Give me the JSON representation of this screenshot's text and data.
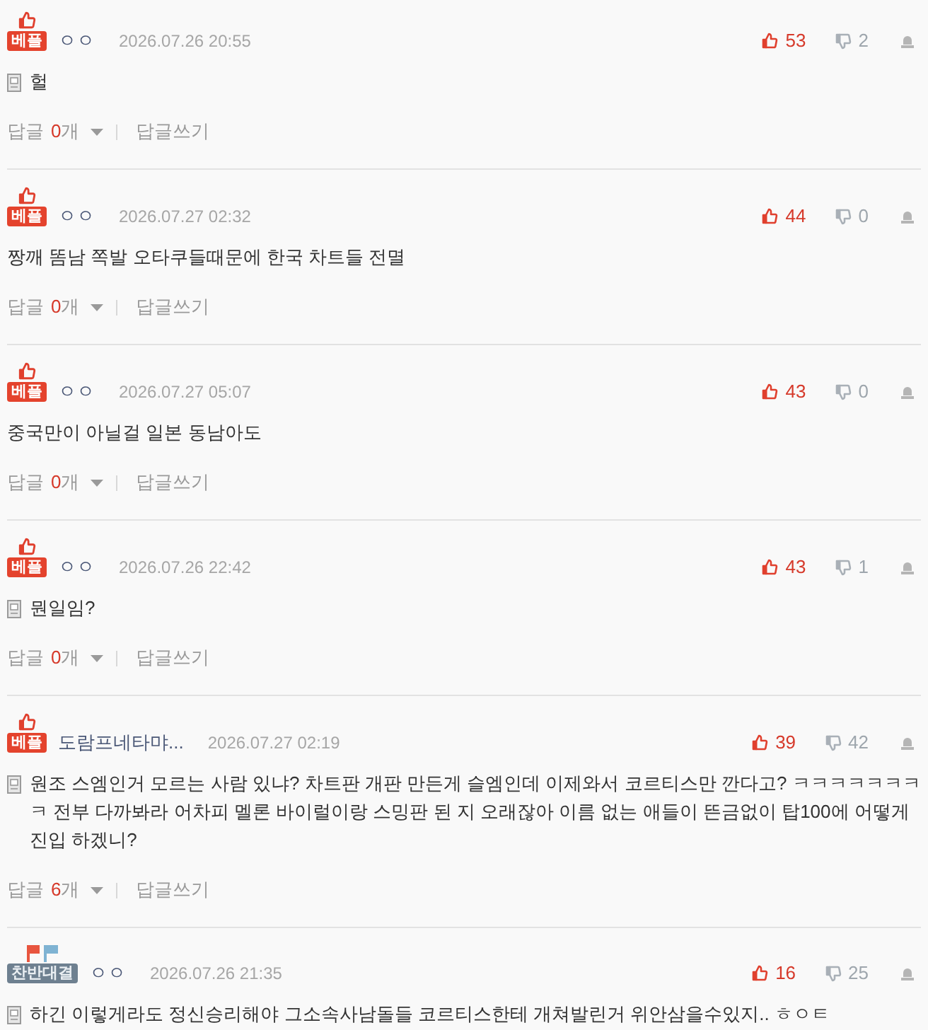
{
  "comments": [
    {
      "badge": {
        "kind": "best",
        "label": "베플"
      },
      "nickname": "ㅇㅇ",
      "date": "2026.07.26 20:55",
      "likes": "53",
      "dislikes": "2",
      "memo": true,
      "text": "헐",
      "replies": {
        "label": "답글",
        "count": "0",
        "unit": "개"
      },
      "write_reply": "답글쓰기"
    },
    {
      "badge": {
        "kind": "best",
        "label": "베플"
      },
      "nickname": "ㅇㅇ",
      "date": "2026.07.27 02:32",
      "likes": "44",
      "dislikes": "0",
      "memo": false,
      "text": "짱깨 똠남 쪽발 오타쿠들때문에 한국 차트들 전멸",
      "replies": {
        "label": "답글",
        "count": "0",
        "unit": "개"
      },
      "write_reply": "답글쓰기"
    },
    {
      "badge": {
        "kind": "best",
        "label": "베플"
      },
      "nickname": "ㅇㅇ",
      "date": "2026.07.27 05:07",
      "likes": "43",
      "dislikes": "0",
      "memo": false,
      "text": "중국만이 아닐걸 일본 동남아도",
      "replies": {
        "label": "답글",
        "count": "0",
        "unit": "개"
      },
      "write_reply": "답글쓰기"
    },
    {
      "badge": {
        "kind": "best",
        "label": "베플"
      },
      "nickname": "ㅇㅇ",
      "date": "2026.07.26 22:42",
      "likes": "43",
      "dislikes": "1",
      "memo": true,
      "text": "뭔일임?",
      "replies": {
        "label": "답글",
        "count": "0",
        "unit": "개"
      },
      "write_reply": "답글쓰기"
    },
    {
      "badge": {
        "kind": "best",
        "label": "베플"
      },
      "nickname": "도람프네타먀...",
      "date": "2026.07.27 02:19",
      "likes": "39",
      "dislikes": "42",
      "memo": true,
      "text": "원조 스엠인거 모르는 사람 있냐? 차트판 개판 만든게 슬엠인데 이제와서 코르티스만 깐다고? ㅋㅋㅋㅋㅋㅋㅋㅋ 전부 다까봐라 어차피 멜론 바이럴이랑 스밍판 된 지 오래잖아 이름 없는 애들이 뜬금없이 탑100에 어떻게 진입 하겠니?",
      "replies": {
        "label": "답글",
        "count": "6",
        "unit": "개"
      },
      "write_reply": "답글쓰기"
    },
    {
      "badge": {
        "kind": "debate",
        "label": "찬반대결"
      },
      "nickname": "ㅇㅇ",
      "date": "2026.07.26 21:35",
      "likes": "16",
      "dislikes": "25",
      "memo": true,
      "text": "하긴 이렇게라도 정신승리해야 그소속사남돌들 코르티스한테 개쳐발린거 위안삼을수있지.. ㅎㅇㅌ"
    }
  ]
}
